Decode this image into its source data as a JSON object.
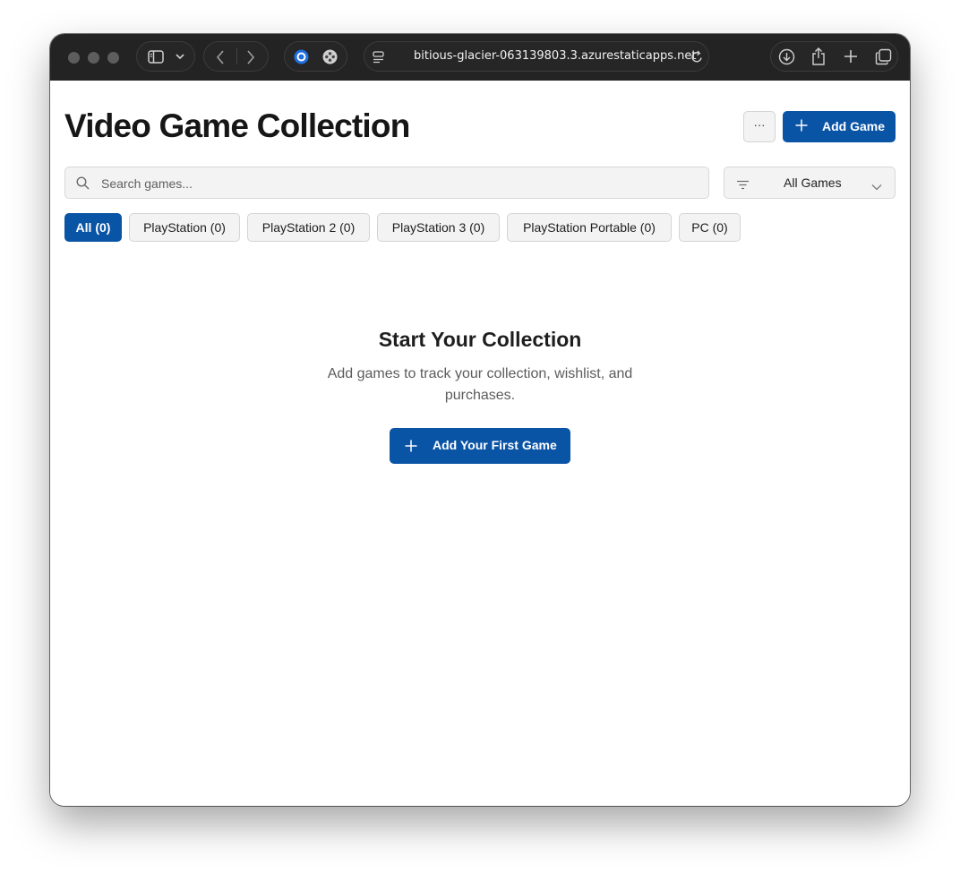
{
  "browser": {
    "url": "bitious-glacier-063139803.3.azurestaticapps.net"
  },
  "header": {
    "title": "Video Game Collection",
    "more_label": "···",
    "add_label": "Add Game"
  },
  "search": {
    "placeholder": "Search games..."
  },
  "filter": {
    "selected": "All Games"
  },
  "chips": [
    {
      "label": "All (0)",
      "active": true
    },
    {
      "label": "PlayStation (0)",
      "active": false
    },
    {
      "label": "PlayStation 2 (0)",
      "active": false
    },
    {
      "label": "PlayStation 3 (0)",
      "active": false
    },
    {
      "label": "PlayStation Portable (0)",
      "active": false
    },
    {
      "label": "PC (0)",
      "active": false
    }
  ],
  "empty_state": {
    "title": "Start Your Collection",
    "text": "Add games to track your collection, wishlist, and purchases.",
    "button_label": "Add Your First Game"
  },
  "colors": {
    "accent": "#0a54a6",
    "toolbar": "#232323"
  },
  "icons": {
    "sidebar": "sidebar-icon",
    "back": "chevron-left-icon",
    "forward": "chevron-right-icon",
    "download": "download-icon",
    "share": "share-icon",
    "new_tab": "plus-icon",
    "tabs": "tabs-overview-icon",
    "search": "search-icon",
    "filter": "filter-icon"
  }
}
